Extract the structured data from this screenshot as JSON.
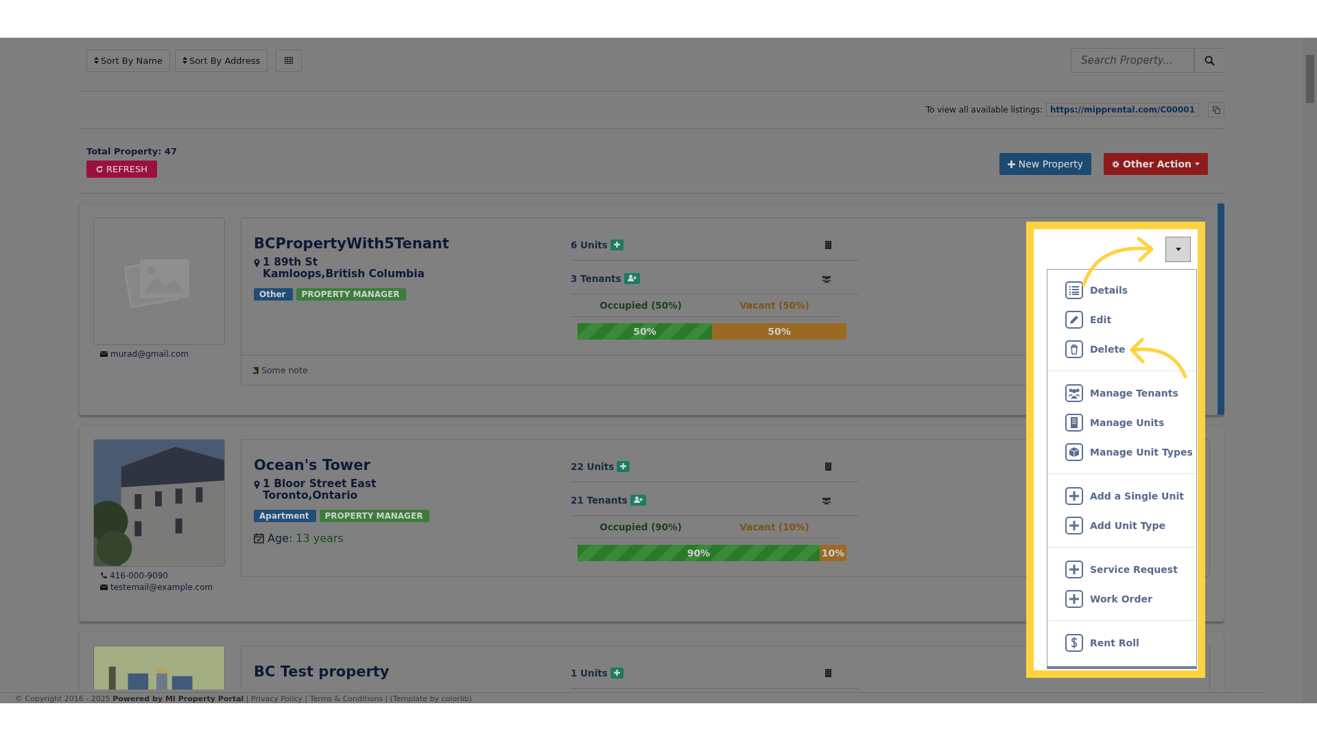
{
  "toolbar": {
    "sort_buttons": [
      {
        "label": "Sort By Name"
      },
      {
        "label": "Sort By Address"
      }
    ],
    "search": {
      "placeholder": "Search Property..."
    }
  },
  "listings": {
    "label": "To view all available listings:",
    "url": "https://mipprental.com/C00001"
  },
  "summary": {
    "total": "Total Property: 47",
    "refresh": "REFRESH"
  },
  "actions": [
    {
      "label": "New Property",
      "kind": "new"
    },
    {
      "label": "Other Action",
      "kind": "other"
    }
  ],
  "properties": [
    {
      "name": "BCPropertyWith5Tenant",
      "address_line1": "1 89th St",
      "address_line2": "Kamloops,British Columbia",
      "kind": "placeholder",
      "active": true,
      "tags": [
        {
          "label": "Other",
          "color": "#1f4e78"
        },
        {
          "label": "PROPERTY MANAGER",
          "color": "#3c7d3c"
        }
      ],
      "note": "Some note",
      "email": "murad@gmail.com",
      "units": "6 Units",
      "tenants": "3 Tenants",
      "occupied_label": "Occupied (50%)",
      "vacant_label": "Vacant (50%)",
      "level": 0.5,
      "occupied_text": "50%",
      "vacant_text": "50%"
    },
    {
      "name": "Ocean's Tower",
      "address_line1": "1 Bloor Street East",
      "address_line2": "Toronto,Ontario",
      "kind": "picture",
      "active": false,
      "tags": [
        {
          "label": "Apartment",
          "color": "#1f4e78"
        },
        {
          "label": "PROPERTY MANAGER",
          "color": "#3c7d3c"
        }
      ],
      "age_label": "Age:",
      "age_value": "13 years",
      "phone": "416-000-9090",
      "email": "testemail@example.com",
      "units": "22 Units",
      "tenants": "21 Tenants",
      "occupied_label": "Occupied (90%)",
      "vacant_label": "Vacant (10%)",
      "level": 0.9,
      "occupied_text": "90%",
      "vacant_text": "10%"
    },
    {
      "name": "BC Test property",
      "kind": "picture",
      "active": false,
      "units": "1 Units"
    }
  ],
  "menu": {
    "groups": [
      [
        {
          "label": "Details"
        },
        {
          "label": "Edit"
        },
        {
          "label": "Delete"
        }
      ],
      [
        {
          "label": "Manage Tenants"
        },
        {
          "label": "Manage Units"
        },
        {
          "label": "Manage Unit Types"
        }
      ],
      [
        {
          "label": "Add a Single Unit"
        },
        {
          "label": "Add Unit Type"
        }
      ],
      [
        {
          "label": "Service Request"
        },
        {
          "label": "Work Order"
        }
      ],
      [
        {
          "label": "Rent Roll"
        }
      ]
    ]
  },
  "footer": {
    "text": "© Copyright 2016 - 2025 **Powered by MI Property Portal** | Privacy Policy | Terms & Conditions | (Template by colorlib)"
  }
}
